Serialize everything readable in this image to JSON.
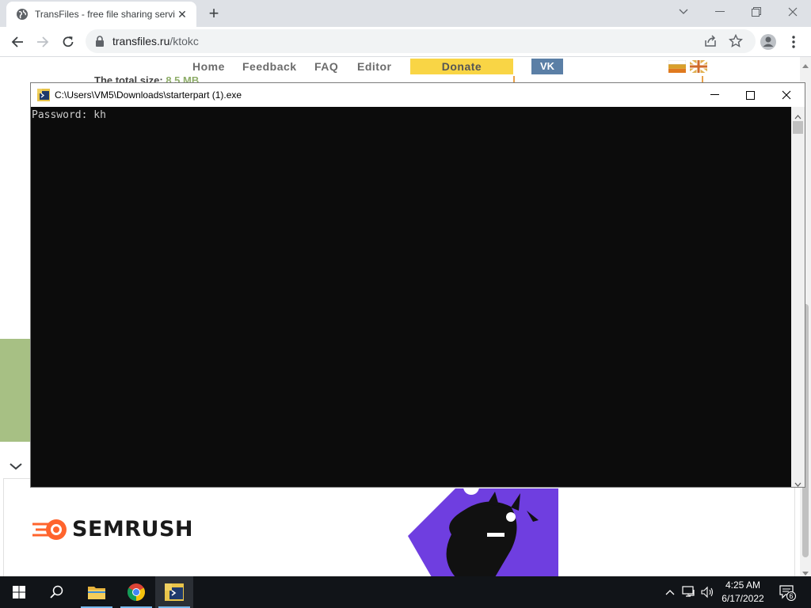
{
  "browser": {
    "tab_title": "TransFiles - free file sharing servi",
    "url_host": "transfiles.ru",
    "url_path": "/ktokc"
  },
  "site": {
    "nav": [
      "Home",
      "Feedback",
      "FAQ",
      "Editor"
    ],
    "donate": "Donate",
    "vk": "VK",
    "size_label": "The total size:",
    "size_value": "8.5 MB"
  },
  "ad": {
    "brand": "SEMRUSH"
  },
  "console": {
    "title": "C:\\Users\\VM5\\Downloads\\starterpart (1).exe",
    "output": "Password: kh"
  },
  "taskbar": {
    "time": "4:25 AM",
    "date": "6/17/2022",
    "notification_count": "6"
  },
  "colors": {
    "donate_bg": "#f9d545",
    "vk_bg": "#5b7fa6",
    "semrush_orange": "#ff642d",
    "ad_purple": "#6f3ee0"
  }
}
